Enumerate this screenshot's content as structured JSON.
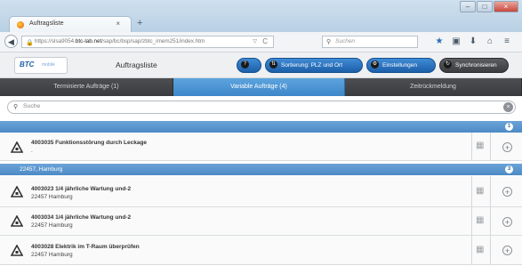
{
  "browser": {
    "tab_title": "Auftragsliste",
    "tab_close": "×",
    "new_tab": "+",
    "window_buttons": [
      "–",
      "□",
      "×"
    ],
    "url_prefix": "https://slsa9054.",
    "url_domain": "btc-lab.net",
    "url_path": "/sap/bc/bsp/sap/zbtc_imem251/index.htm",
    "search_placeholder": "Suchen"
  },
  "app": {
    "logo_text": "BTC",
    "logo_sub": "mobile",
    "title": "Auftragsliste",
    "buttons": [
      {
        "label": "",
        "icon": "help-icon"
      },
      {
        "label": "Sortierung: PLZ und Ort",
        "icon": "sort-icon"
      },
      {
        "label": "Einstellungen",
        "icon": "settings-icon"
      },
      {
        "label": "Synchronisieren",
        "icon": "sync-icon"
      }
    ],
    "tabs": [
      {
        "label": "Terminierte Aufträge (1)",
        "active": false
      },
      {
        "label": "Variable Aufträge (4)",
        "active": true
      },
      {
        "label": "Zeitrückmeldung",
        "active": false
      }
    ],
    "search_placeholder": "Suche",
    "groups": [
      {
        "header": "",
        "count": "1",
        "items": [
          {
            "title": "4003035 Funktionsstörung durch Leckage",
            "subtitle": "."
          }
        ]
      },
      {
        "header": "22457, Hamburg",
        "count": "3",
        "items": [
          {
            "title": "4003023 1/4 jährliche Wartung und-2",
            "subtitle": "22457 Hamburg"
          },
          {
            "title": "4003034 1/4 jährliche Wartung und-2",
            "subtitle": "22457 Hamburg"
          },
          {
            "title": "4003028 Elektrik im T-Raum überprüfen",
            "subtitle": "22457 Hamburg"
          }
        ]
      }
    ]
  },
  "colors": {
    "accent": "#3d86c8",
    "tab_dark": "#3a3b3e",
    "button_blue": "#1d5fa8"
  }
}
